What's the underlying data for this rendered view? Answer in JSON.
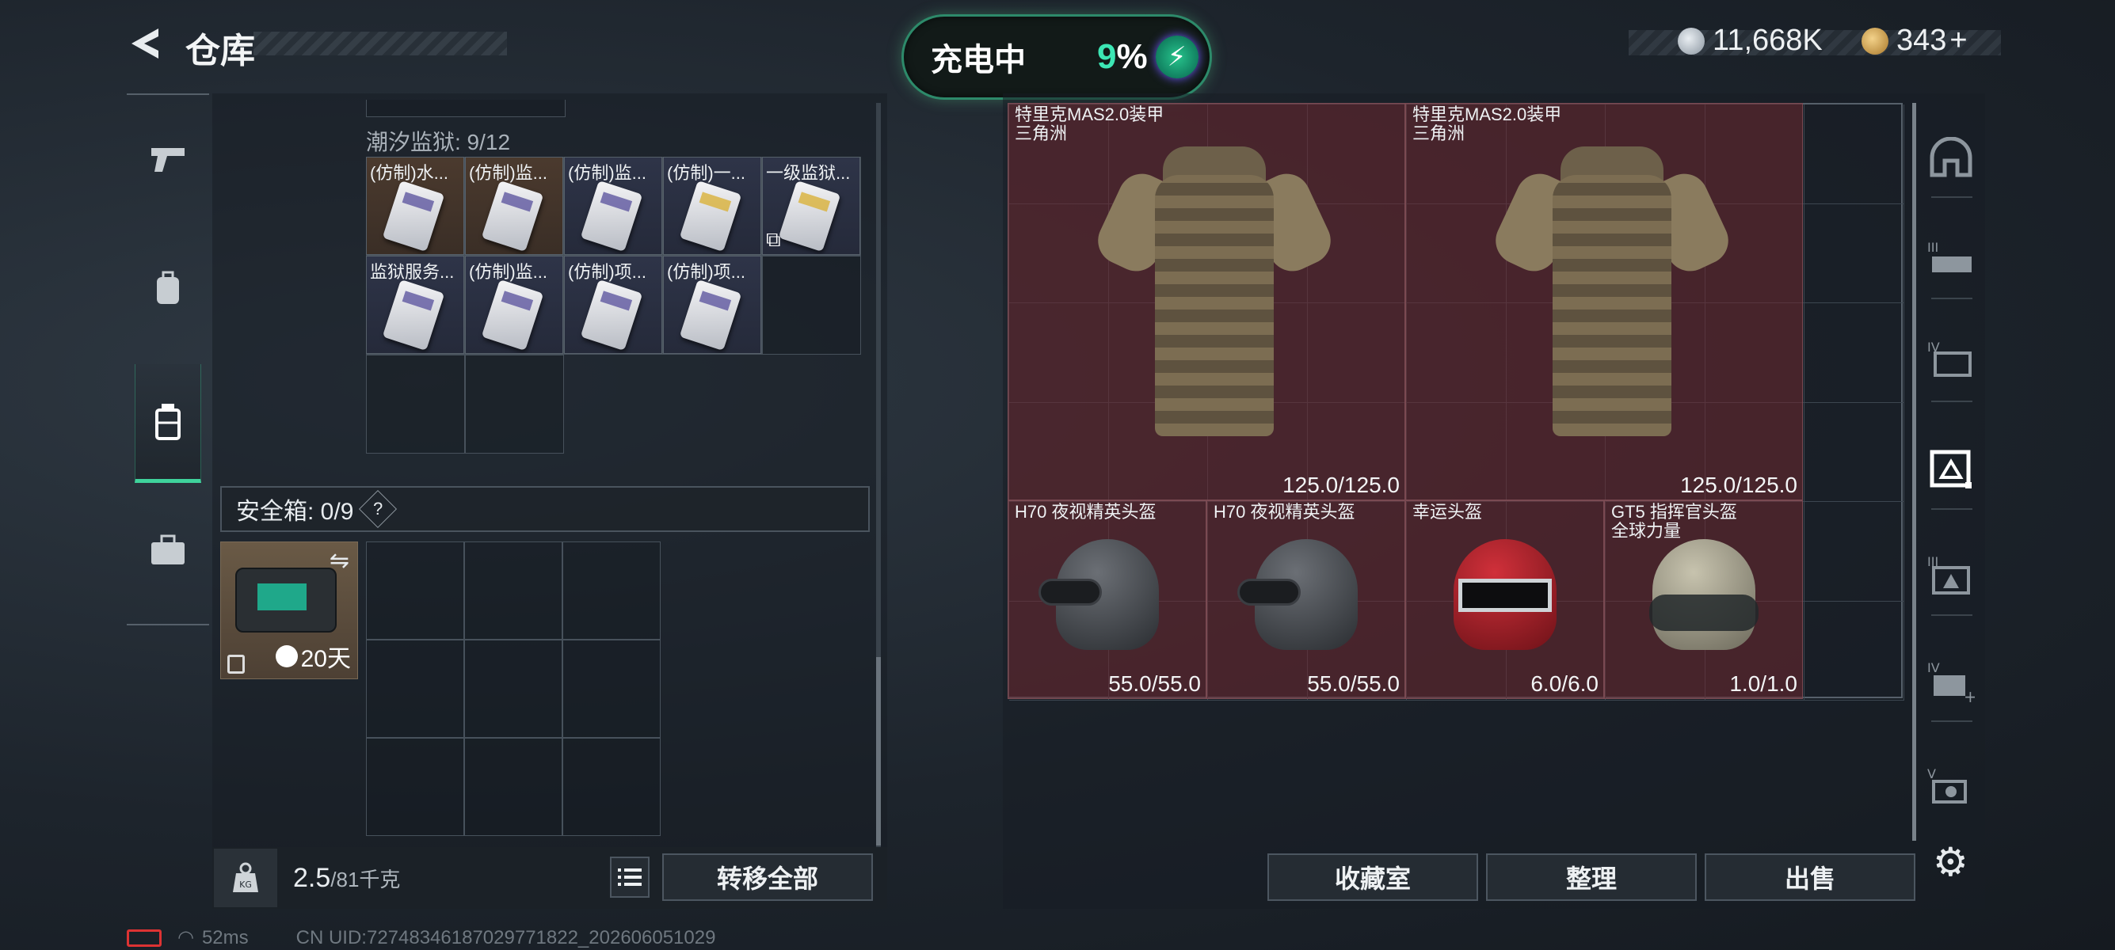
{
  "header": {
    "title": "仓库",
    "charging_label": "充电中",
    "charging_percent": "9",
    "charging_percent_suffix": "%",
    "currency_1": "11,668K",
    "currency_2": "343",
    "currency_2_add": "+"
  },
  "left_panel": {
    "tidal_prison_label": "潮汐监狱: 9/12",
    "items": [
      {
        "name": "(仿制)水...",
        "bg": "brown",
        "card": "silver"
      },
      {
        "name": "(仿制)监...",
        "bg": "brown",
        "card": "silver"
      },
      {
        "name": "(仿制)监...",
        "bg": "blue",
        "card": "silver"
      },
      {
        "name": "(仿制)一...",
        "bg": "blue",
        "card": "gold"
      },
      {
        "name": "一级监狱...",
        "bg": "blue",
        "card": "gold"
      },
      {
        "name": "监狱服务...",
        "bg": "blue",
        "card": "silver"
      },
      {
        "name": "(仿制)监...",
        "bg": "blue",
        "card": "silver"
      },
      {
        "name": "(仿制)项...",
        "bg": "blue",
        "card": "silver"
      },
      {
        "name": "(仿制)项...",
        "bg": "blue",
        "card": "silver"
      }
    ],
    "safe_box_label": "安全箱: 0/9",
    "safe_box_help": "?",
    "safe_box_days": "20天",
    "weight_current": "2.5",
    "weight_max": "/81千克",
    "transfer_all": "转移全部"
  },
  "right_panel": {
    "items": [
      {
        "name": "特里克MAS2.0装甲\n三角洲",
        "durability": "125.0/125.0",
        "type": "vest"
      },
      {
        "name": "特里克MAS2.0装甲\n三角洲",
        "durability": "125.0/125.0",
        "type": "vest"
      },
      {
        "name": "H70 夜视精英头盔",
        "durability": "55.0/55.0",
        "type": "ngv"
      },
      {
        "name": "H70 夜视精英头盔",
        "durability": "55.0/55.0",
        "type": "ngv"
      },
      {
        "name": "幸运头盔",
        "durability": "6.0/6.0",
        "type": "red"
      },
      {
        "name": "GT5 指挥官头盔\n全球力量",
        "durability": "1.0/1.0",
        "type": "tan"
      }
    ],
    "buttons": {
      "collection": "收藏室",
      "organize": "整理",
      "sell": "出售"
    }
  },
  "status_bar": {
    "ping": "52ms",
    "uid": "CN UID:7274834618702977182​2_202606051029"
  },
  "colors": {
    "accent": "#3fd39c",
    "item_red": "#6e2830"
  },
  "icons": [
    "back-arrow-icon",
    "silver-coin-icon",
    "gold-coin-icon",
    "pistol-icon",
    "backpack-icon",
    "chest-rig-icon",
    "briefcase-icon",
    "kg-weight-icon",
    "list-icon",
    "gear-icon",
    "helmet-tab-icon",
    "vest-tab-icon"
  ]
}
